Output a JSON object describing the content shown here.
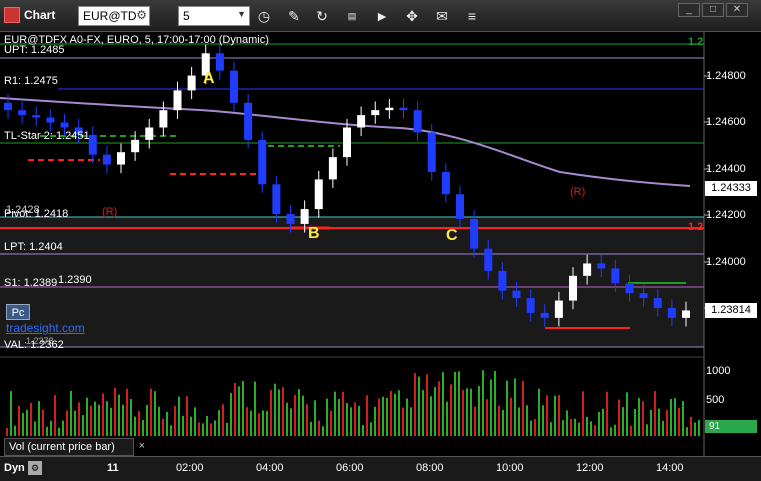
{
  "window": {
    "title": "Chart",
    "symbol": "EUR@TD",
    "interval": "5",
    "buttons": [
      "clock-icon",
      "pencil-icon",
      "refresh-icon",
      "ssb-icon",
      "play-icon",
      "move-icon",
      "chat-icon",
      "menu-icon"
    ]
  },
  "chart_header": "EUR@TDFX A0-FX, EURO, 5, 17:00-17:00 (Dynamic)",
  "levels": {
    "upt": "UPT: 1.2485",
    "r1": "R1: 1.2475",
    "tl_star": "TL-Star 2: 1.2451",
    "pivot": "Pivot: 1.2418",
    "lpt": "LPT: 1.2404",
    "s1": "S1: 1.2389",
    "s1_extra": "1.2390",
    "val": "VAL: 1.2362",
    "val_extra": "1.2378",
    "pivot_extra": "1.2428"
  },
  "annotations": {
    "a": "A",
    "b": "B",
    "c": "C",
    "pc": "Pc",
    "site": "tradesight.com",
    "r_left": "(R)",
    "r_right": "(R)"
  },
  "price_axis": {
    "ticks": [
      "1.24800",
      "1.24600",
      "1.24400",
      "1.24200",
      "1.24000",
      "1.23800"
    ],
    "current_mid": "1.24333",
    "current_price": "1.23814",
    "top_tag": "1.2",
    "red_tag": "1.2"
  },
  "volume": {
    "panel_label": "Vol (current price bar)",
    "ticks": [
      "1000",
      "500"
    ],
    "current": "91"
  },
  "time_axis": {
    "dyn": "Dyn",
    "labels": [
      "11",
      "02:00",
      "04:00",
      "06:00",
      "08:00",
      "10:00",
      "12:00",
      "14:00"
    ]
  },
  "colors": {
    "up_bar": "#ffffff",
    "down_bar": "#1f3cff",
    "green_level": "#1e9e1e",
    "red_level": "#ff2020",
    "purple_ma": "#a58ad0",
    "yellow": "#ffeb3b",
    "magenta": "#e020e0"
  },
  "chart_data": {
    "type": "candlestick",
    "title": "EUR@TDFX A0-FX, EURO, 5, 17:00-17:00 (Dynamic)",
    "y_range": [
      1.2365,
      1.2492
    ],
    "x_labels": [
      "11",
      "02:00",
      "04:00",
      "06:00",
      "08:00",
      "10:00",
      "12:00",
      "14:00"
    ],
    "closes": [
      1.2462,
      1.246,
      1.2459,
      1.2457,
      1.2455,
      1.2452,
      1.2444,
      1.244,
      1.2445,
      1.245,
      1.2455,
      1.2462,
      1.247,
      1.2476,
      1.2485,
      1.2478,
      1.2465,
      1.245,
      1.2432,
      1.242,
      1.2416,
      1.2422,
      1.2434,
      1.2443,
      1.2455,
      1.246,
      1.2462,
      1.2463,
      1.2462,
      1.2453,
      1.2437,
      1.2428,
      1.2418,
      1.2406,
      1.2397,
      1.2389,
      1.2386,
      1.238,
      1.2378,
      1.2385,
      1.2395,
      1.24,
      1.2398,
      1.2392,
      1.2388,
      1.2386,
      1.2382,
      1.2378,
      1.2381
    ]
  }
}
